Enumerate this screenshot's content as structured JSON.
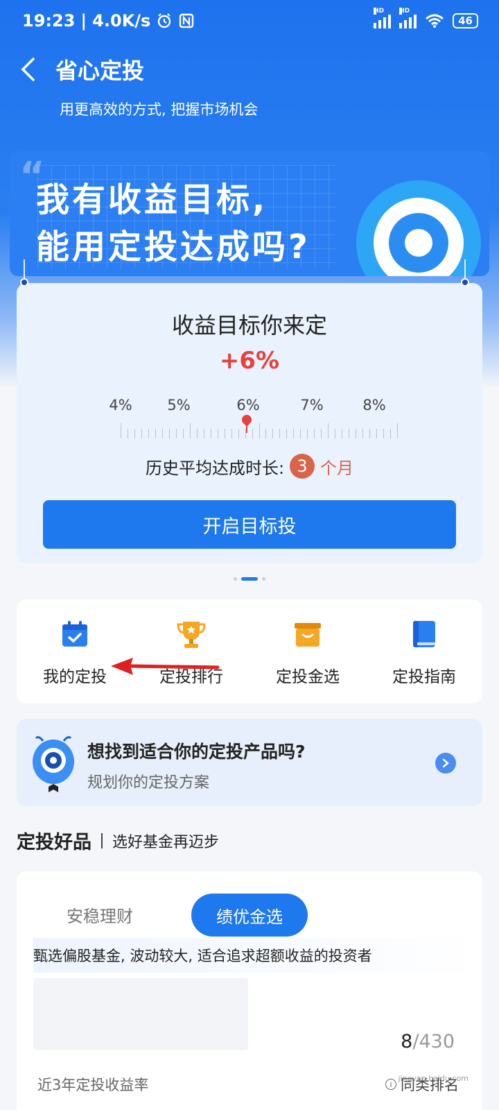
{
  "status_bar": {
    "time": "19:23",
    "speed": "4.0K/s",
    "battery": "46",
    "hd1": "HD",
    "hd2": "HD"
  },
  "nav": {
    "title": "省心定投",
    "subtitle": "用更高效的方式, 把握市场机会"
  },
  "banner": {
    "line1": "我有收益目标,",
    "line2": "能用定投达成吗?",
    "quote_mark": "“"
  },
  "goal_card": {
    "title": "收益目标你来定",
    "selected_pct": "+6%",
    "selected_value": 6,
    "tick_labels": [
      "4%",
      "5%",
      "6%",
      "7%",
      "8%"
    ],
    "history_label": "历史平均达成时长:",
    "history_value": "3",
    "history_unit": "个月",
    "start_button": "开启目标投"
  },
  "carousel": {
    "count": 3,
    "active": 1
  },
  "menu": {
    "items": [
      {
        "label": "我的定投",
        "icon": "calendar-check-icon",
        "color": "#2a7ff0"
      },
      {
        "label": "定投排行",
        "icon": "trophy-icon",
        "color": "#f5a623"
      },
      {
        "label": "定投金选",
        "icon": "folder-box-icon",
        "color": "#f5a623"
      },
      {
        "label": "定投指南",
        "icon": "book-icon",
        "color": "#2a7ff0"
      }
    ]
  },
  "promo": {
    "title": "想找到适合你的定投产品吗?",
    "subtitle": "规划你的定投方案"
  },
  "section": {
    "title": "定投好品",
    "subtitle": "选好基金再迈步"
  },
  "list": {
    "tabs": [
      "安稳理财",
      "绩优金选"
    ],
    "active_tab": 1,
    "description": "甄选偏股基金, 波动较大, 适合追求超额收益的投资者",
    "rank": "8",
    "rank_total": "/430",
    "metric_label": "近3年定投收益率",
    "peer_label": "同类排名"
  },
  "watermark": "jingyan.baidu.com",
  "colors": {
    "primary": "#1e78ee",
    "accent_red": "#e8413c",
    "accent_orange": "#d9644a"
  }
}
